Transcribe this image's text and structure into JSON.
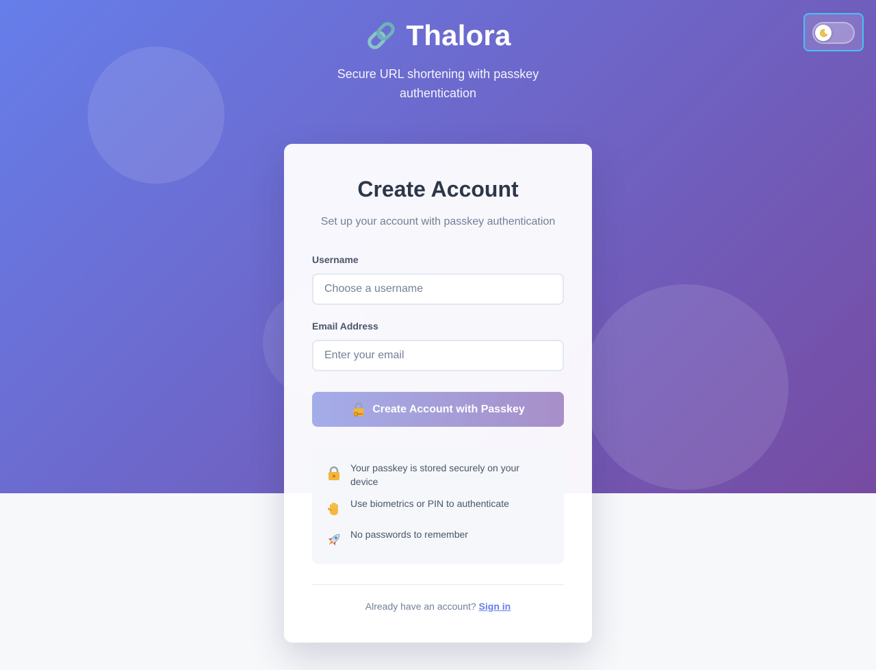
{
  "app": {
    "name": "Thalora",
    "tagline": "Secure URL shortening with passkey authentication",
    "logo_icon": "link-icon"
  },
  "theme_toggle": {
    "icon": "moon-icon",
    "state": "light"
  },
  "card": {
    "title": "Create Account",
    "subtitle": "Set up your account with passkey authentication",
    "username": {
      "label": "Username",
      "placeholder": "Choose a username",
      "value": ""
    },
    "email": {
      "label": "Email Address",
      "placeholder": "Enter your email",
      "value": ""
    },
    "submit": {
      "icon": "lock-with-key-icon",
      "label": "Create Account with Passkey"
    },
    "features": [
      {
        "icon": "lock-icon",
        "text": "Your passkey is stored securely on your device"
      },
      {
        "icon": "raised-hand-icon",
        "text": "Use biometrics or PIN to authenticate"
      },
      {
        "icon": "rocket-icon",
        "text": "No passwords to remember"
      }
    ],
    "footer": {
      "prompt": "Already have an account?",
      "link": "Sign in"
    }
  },
  "colors": {
    "gradient_start": "#667eea",
    "gradient_end": "#764ba2",
    "title_text": "#2d3748",
    "muted_text": "#718096",
    "link": "#667eea",
    "toggle_focus_ring": "#45c3f5"
  }
}
